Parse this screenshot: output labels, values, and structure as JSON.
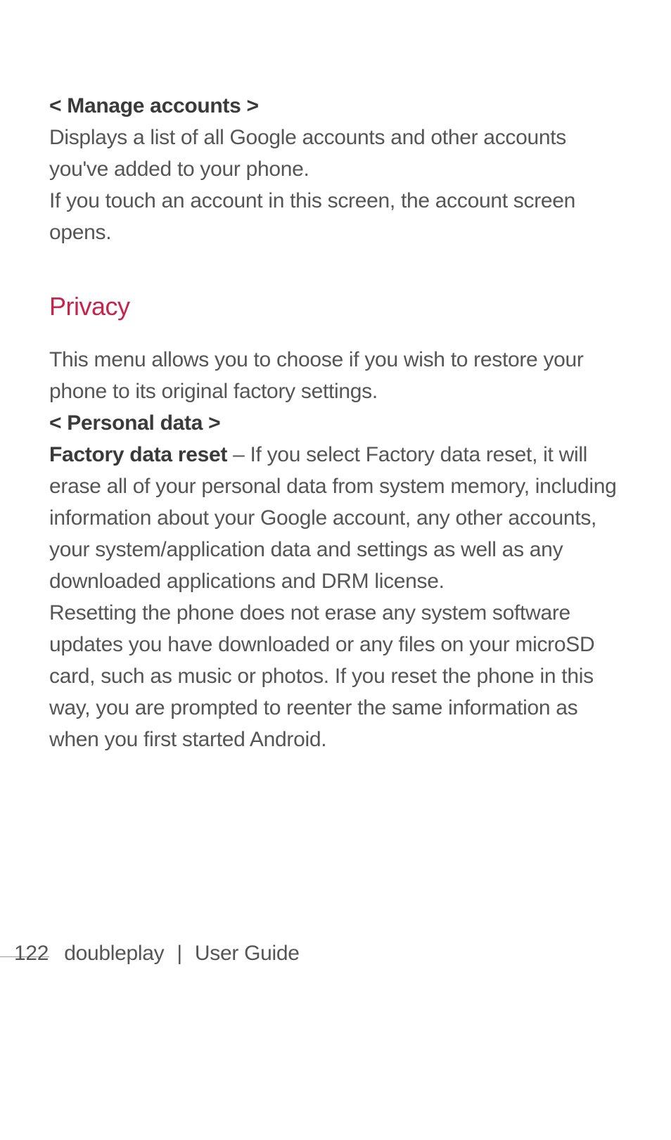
{
  "sections": {
    "manage_accounts": {
      "label": "< Manage accounts >",
      "para1": "Displays a list of all Google accounts and other accounts you've added to your phone.",
      "para2": "If you touch an account in this screen, the account screen opens."
    },
    "privacy": {
      "heading": "Privacy",
      "intro": "This menu allows you to choose if you wish to restore your phone to its original factory settings.",
      "personal_data_label": "< Personal data >",
      "factory_reset_bold": "Factory data reset",
      "factory_reset_text": " – If you select Factory data reset, it will erase all of your personal data from system memory, including information about your Google account, any other accounts, your system/application data and settings as well as any downloaded applications and DRM license.",
      "reset_note": "Resetting the phone does not erase any system software updates you have downloaded or any files on your microSD card, such as music or photos. If you reset the phone in this way, you are prompted to reenter the same information as when you first started Android."
    }
  },
  "footer": {
    "page_number": "122",
    "product": "doubleplay",
    "separator": "|",
    "doc_type": "User Guide"
  }
}
